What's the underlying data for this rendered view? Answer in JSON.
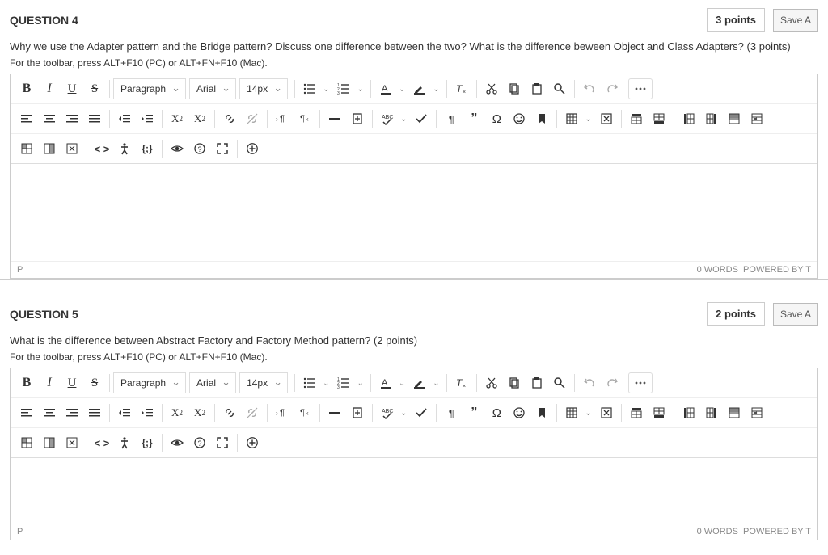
{
  "questions": [
    {
      "title": "QUESTION 4",
      "points": "3 points",
      "save": "Save A",
      "prompt": "Why we use the Adapter pattern and the Bridge pattern? Discuss one difference between the two? What is the difference beween Object and Class Adapters? (3 points)",
      "hint": "For the toolbar, press ALT+F10 (PC) or ALT+FN+F10 (Mac).",
      "path": "P",
      "wc": "0 WORDS",
      "powered": "POWERED BY T"
    },
    {
      "title": "QUESTION 5",
      "points": "2 points",
      "save": "Save A",
      "prompt": "What is the difference between Abstract Factory and Factory Method pattern? (2 points)",
      "hint": "For the toolbar, press ALT+F10 (PC) or ALT+FN+F10 (Mac).",
      "path": "P",
      "wc": "0 WORDS",
      "powered": "POWERED BY T"
    }
  ],
  "tb": {
    "para": "Paragraph",
    "font": "Arial",
    "size": "14px"
  }
}
